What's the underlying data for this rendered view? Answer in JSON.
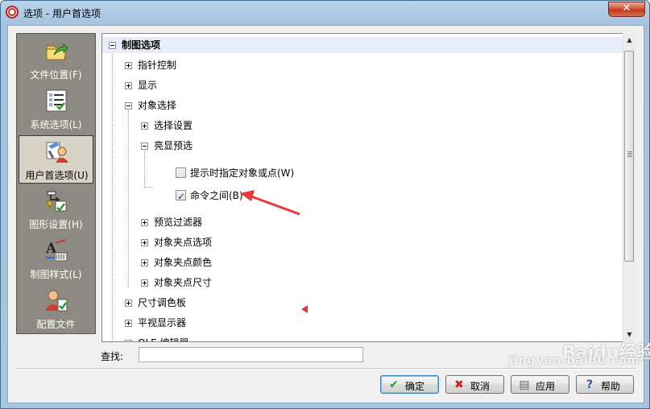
{
  "window": {
    "title": "选项 - 用户首选项",
    "close_symbol": "✕"
  },
  "categories": [
    {
      "label": "文件位置(F)",
      "icon": "folder-arrow-icon",
      "selected": false
    },
    {
      "label": "系统选项(L)",
      "icon": "checklist-icon",
      "selected": false
    },
    {
      "label": "用户首选项(U)",
      "icon": "user-pen-icon",
      "selected": true
    },
    {
      "label": "图形设置(H)",
      "icon": "graphics-settings-icon",
      "selected": false
    },
    {
      "label": "制图样式(L)",
      "icon": "drafting-style-icon",
      "selected": false
    },
    {
      "label": "配置文件",
      "icon": "profile-user-icon",
      "selected": false
    }
  ],
  "tree": {
    "root": "制图选项",
    "items": {
      "pointer_control": "指针控制",
      "display": "显示",
      "object_selection": "对象选择",
      "selection_settings": "选择设置",
      "highlight_preview": "亮显预选",
      "prompt_option": "提示时指定对象或点(W)",
      "between_commands": "命令之间(B)",
      "preview_filter": "预览过滤器",
      "grip_options": "对象夹点选项",
      "grip_color": "对象夹点颜色",
      "grip_size": "对象夹点尺寸",
      "dim_palette": "尺寸调色板",
      "plan_display": "平视显示器",
      "ole_editor": "OLE 编辑器"
    },
    "checkboxes": {
      "prompt_option_checked": false,
      "between_commands_checked": true
    }
  },
  "search": {
    "label": "查找:",
    "value": ""
  },
  "buttons": {
    "ok": "确定",
    "cancel": "取消",
    "apply": "应用",
    "help": "帮助"
  },
  "annotation": {
    "arrow_color": "#e8383d"
  },
  "watermark": {
    "text": "Baidu经验",
    "url": "jingyan.baidu.com"
  }
}
